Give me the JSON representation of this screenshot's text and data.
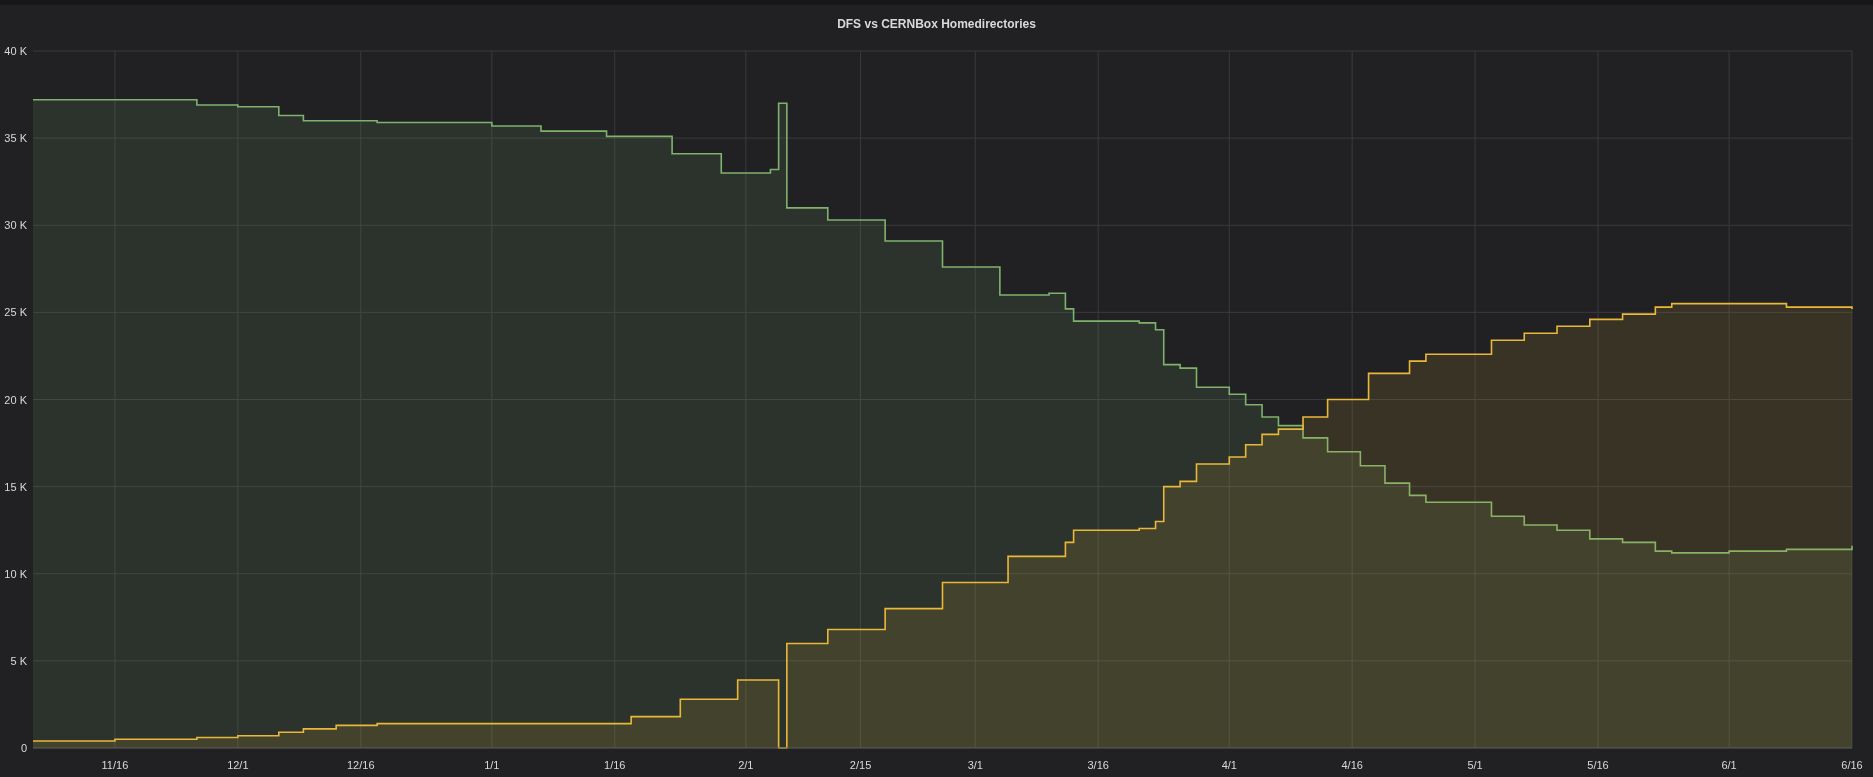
{
  "panel": {
    "title": "DFS vs CERNBox Homedirectories",
    "chart_data": {
      "type": "area",
      "categories": [
        null,
        null,
        null,
        null,
        null,
        null,
        null,
        null,
        null,
        null,
        "11/16",
        null,
        null,
        null,
        null,
        null,
        null,
        null,
        null,
        null,
        null,
        null,
        null,
        null,
        null,
        "12/1",
        null,
        null,
        null,
        null,
        null,
        null,
        null,
        null,
        null,
        null,
        null,
        null,
        null,
        null,
        "12/16",
        null,
        null,
        null,
        null,
        null,
        null,
        null,
        null,
        null,
        null,
        null,
        null,
        null,
        null,
        null,
        "1/1",
        null,
        null,
        null,
        null,
        null,
        null,
        null,
        null,
        null,
        null,
        null,
        null,
        null,
        null,
        "1/16",
        null,
        null,
        null,
        null,
        null,
        null,
        null,
        null,
        null,
        null,
        null,
        null,
        null,
        null,
        null,
        "2/1",
        null,
        null,
        null,
        null,
        null,
        null,
        null,
        null,
        null,
        null,
        null,
        null,
        null,
        "2/15",
        null,
        null,
        null,
        null,
        null,
        null,
        null,
        null,
        null,
        null,
        null,
        null,
        null,
        "3/1",
        null,
        null,
        null,
        null,
        null,
        null,
        null,
        null,
        null,
        null,
        null,
        null,
        null,
        null,
        "3/16",
        null,
        null,
        null,
        null,
        null,
        null,
        null,
        null,
        null,
        null,
        null,
        null,
        null,
        null,
        null,
        "4/1",
        null,
        null,
        null,
        null,
        null,
        null,
        null,
        null,
        null,
        null,
        null,
        null,
        null,
        null,
        "4/16",
        null,
        null,
        null,
        null,
        null,
        null,
        null,
        null,
        null,
        null,
        null,
        null,
        null,
        null,
        "5/1",
        null,
        null,
        null,
        null,
        null,
        null,
        null,
        null,
        null,
        null,
        null,
        null,
        null,
        null,
        "5/16",
        null,
        null,
        null,
        null,
        null,
        null,
        null,
        null,
        null,
        null,
        null,
        null,
        null,
        null,
        null,
        "6/1",
        null,
        null,
        null,
        null,
        null,
        null,
        null,
        null,
        null,
        null,
        null,
        null,
        null,
        null,
        "6/16"
      ],
      "series": [
        {
          "color": "#7eb26d",
          "values": [
            37200,
            37200,
            37200,
            37200,
            37200,
            37200,
            37200,
            37200,
            37200,
            37200,
            37200,
            37200,
            37200,
            37200,
            37200,
            37200,
            37200,
            37200,
            37200,
            37200,
            36900,
            36900,
            36900,
            36900,
            36900,
            36800,
            36800,
            36800,
            36800,
            36800,
            36300,
            36300,
            36300,
            36000,
            36000,
            36000,
            36000,
            36000,
            36000,
            36000,
            36000,
            36000,
            35900,
            35900,
            35900,
            35900,
            35900,
            35900,
            35900,
            35900,
            35900,
            35900,
            35900,
            35900,
            35900,
            35900,
            35700,
            35700,
            35700,
            35700,
            35700,
            35700,
            35400,
            35400,
            35400,
            35400,
            35400,
            35400,
            35400,
            35400,
            35100,
            35100,
            35100,
            35100,
            35100,
            35100,
            35100,
            35100,
            34100,
            34100,
            34100,
            34100,
            34100,
            34100,
            33000,
            33000,
            33000,
            33000,
            33000,
            33000,
            33200,
            37000,
            31000,
            31000,
            31000,
            31000,
            31000,
            30300,
            30300,
            30300,
            30300,
            30300,
            30300,
            30300,
            29100,
            29100,
            29100,
            29100,
            29100,
            29100,
            29100,
            27600,
            27600,
            27600,
            27600,
            27600,
            27600,
            27600,
            26000,
            26000,
            26000,
            26000,
            26000,
            26000,
            26100,
            26100,
            25200,
            24500,
            24500,
            24500,
            24500,
            24500,
            24500,
            24500,
            24500,
            24400,
            24400,
            24000,
            22000,
            22000,
            21800,
            21800,
            20700,
            20700,
            20700,
            20700,
            20300,
            20300,
            19700,
            19700,
            19000,
            19000,
            18500,
            18500,
            18500,
            17800,
            17800,
            17800,
            17000,
            17000,
            17000,
            17000,
            16200,
            16200,
            16200,
            15200,
            15200,
            15200,
            14500,
            14500,
            14100,
            14100,
            14100,
            14100,
            14100,
            14100,
            14100,
            14100,
            13300,
            13300,
            13300,
            13300,
            12800,
            12800,
            12800,
            12800,
            12500,
            12500,
            12500,
            12500,
            12000,
            12000,
            12000,
            12000,
            11800,
            11800,
            11800,
            11800,
            11300,
            11300,
            11200,
            11200,
            11200,
            11200,
            11200,
            11200,
            11200,
            11300,
            11300,
            11300,
            11300,
            11300,
            11300,
            11300,
            11400,
            11400,
            11400,
            11400,
            11400,
            11400,
            11400,
            11400,
            11600
          ]
        },
        {
          "color": "#eab839",
          "values": [
            400,
            400,
            400,
            400,
            400,
            400,
            400,
            400,
            400,
            400,
            500,
            500,
            500,
            500,
            500,
            500,
            500,
            500,
            500,
            500,
            600,
            600,
            600,
            600,
            600,
            700,
            700,
            700,
            700,
            700,
            900,
            900,
            900,
            1100,
            1100,
            1100,
            1100,
            1300,
            1300,
            1300,
            1300,
            1300,
            1400,
            1400,
            1400,
            1400,
            1400,
            1400,
            1400,
            1400,
            1400,
            1400,
            1400,
            1400,
            1400,
            1400,
            1400,
            1400,
            1400,
            1400,
            1400,
            1400,
            1400,
            1400,
            1400,
            1400,
            1400,
            1400,
            1400,
            1400,
            1400,
            1400,
            1400,
            1800,
            1800,
            1800,
            1800,
            1800,
            1800,
            2800,
            2800,
            2800,
            2800,
            2800,
            2800,
            2800,
            3900,
            3900,
            3900,
            3900,
            3900,
            0,
            6000,
            6000,
            6000,
            6000,
            6000,
            6800,
            6800,
            6800,
            6800,
            6800,
            6800,
            6800,
            8000,
            8000,
            8000,
            8000,
            8000,
            8000,
            8000,
            9500,
            9500,
            9500,
            9500,
            9500,
            9500,
            9500,
            9500,
            11000,
            11000,
            11000,
            11000,
            11000,
            11000,
            11000,
            11800,
            12500,
            12500,
            12500,
            12500,
            12500,
            12500,
            12500,
            12500,
            12600,
            12600,
            13000,
            15000,
            15000,
            15300,
            15300,
            16300,
            16300,
            16300,
            16300,
            16700,
            16700,
            17400,
            17400,
            18000,
            18000,
            18300,
            18300,
            18300,
            19000,
            19000,
            19000,
            20000,
            20000,
            20000,
            20000,
            20000,
            21500,
            21500,
            21500,
            21500,
            21500,
            22200,
            22200,
            22600,
            22600,
            22600,
            22600,
            22600,
            22600,
            22600,
            22600,
            23400,
            23400,
            23400,
            23400,
            23800,
            23800,
            23800,
            23800,
            24200,
            24200,
            24200,
            24200,
            24600,
            24600,
            24600,
            24600,
            24900,
            24900,
            24900,
            24900,
            25300,
            25300,
            25500,
            25500,
            25500,
            25500,
            25500,
            25500,
            25500,
            25500,
            25500,
            25500,
            25500,
            25500,
            25500,
            25500,
            25300,
            25300,
            25300,
            25300,
            25300,
            25300,
            25300,
            25300,
            25200
          ]
        }
      ],
      "grid": true,
      "ylim": [
        0,
        40000
      ],
      "yticks": [
        {
          "value": 0,
          "label": "0"
        },
        {
          "value": 5000,
          "label": "5 K"
        },
        {
          "value": 10000,
          "label": "10 K"
        },
        {
          "value": 15000,
          "label": "15 K"
        },
        {
          "value": 20000,
          "label": "20 K"
        },
        {
          "value": 25000,
          "label": "25 K"
        },
        {
          "value": 30000,
          "label": "30 K"
        },
        {
          "value": 35000,
          "label": "35 K"
        },
        {
          "value": 40000,
          "label": "40 K"
        }
      ]
    }
  }
}
